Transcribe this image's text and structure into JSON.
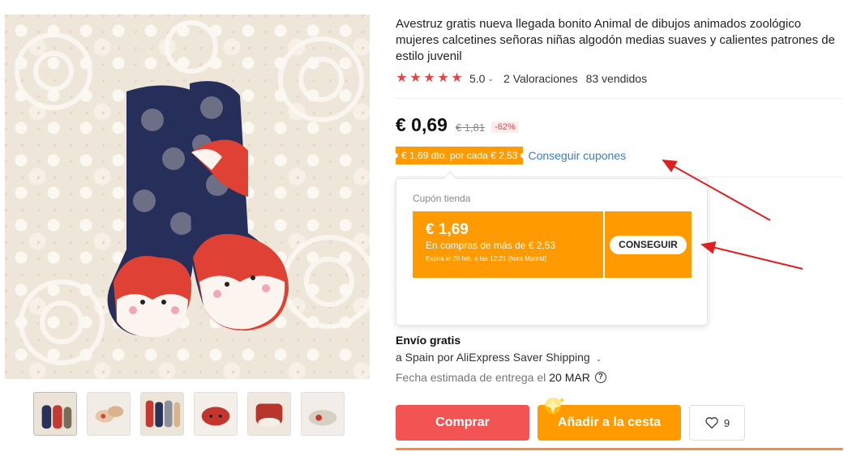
{
  "product": {
    "title": "Avestruz gratis nueva llegada bonito Animal de dibujos animados zoológico mujeres calcetines señoras niñas algodón medias suaves y calientes patrones de estilo juvenil",
    "rating": "5.0",
    "reviews": "2 Valoraciones",
    "sold": "83 vendidos",
    "stars": "★",
    "price": "€ 0,69",
    "old_price": "€ 1,81",
    "discount": "-62%"
  },
  "coupon": {
    "tag": "€ 1,69 dto. por cada € 2,53",
    "link": "Conseguir cupones"
  },
  "popover": {
    "title": "Cupón tienda",
    "amount": "€ 1,69",
    "min": "En compras de más de € 2,53",
    "expiry": "Expira el 26 feb. a las 12:21 (hora Madrid)",
    "button": "CONSEGUIR"
  },
  "shipping": {
    "title": "Envío gratis",
    "method": "a Spain por AliExpress Saver Shipping",
    "delivery_label": "Fecha estimada de entrega el",
    "delivery_date": "20 MAR",
    "help": "?"
  },
  "actions": {
    "buy": "Comprar",
    "cart": "Añadir a la cesta",
    "wish_count": "9"
  },
  "colors": {
    "accent_red": "#f25353",
    "accent_orange": "#ff9a00",
    "star_red": "#e64545",
    "link_blue": "#3a7cc2"
  },
  "icons": [
    "star-icon",
    "chevron-down-icon",
    "help-icon",
    "heart-icon",
    "sparkle-icon"
  ]
}
